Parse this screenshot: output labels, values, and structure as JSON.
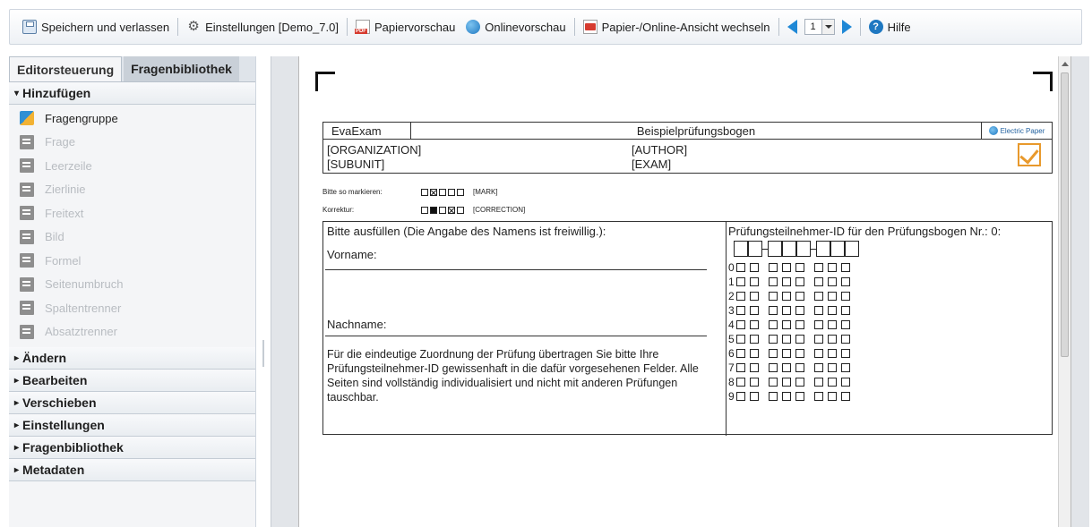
{
  "toolbar": {
    "save_label": "Speichern und verlassen",
    "settings_label": "Einstellungen [Demo_7.0]",
    "paper_preview_label": "Papiervorschau",
    "online_preview_label": "Onlinevorschau",
    "switch_view_label": "Papier-/Online-Ansicht wechseln",
    "page_value": "1",
    "help_label": "Hilfe"
  },
  "sidebar": {
    "tabs": [
      "Editorsteuerung",
      "Fragenbibliothek"
    ],
    "add_section": "Hinzufügen",
    "items": [
      {
        "label": "Fragengruppe",
        "icon": "question-group-icon"
      },
      {
        "label": "Frage",
        "icon": "question-icon"
      },
      {
        "label": "Leerzeile",
        "icon": "blank-line-icon"
      },
      {
        "label": "Zierlinie",
        "icon": "decorative-line-icon"
      },
      {
        "label": "Freitext",
        "icon": "free-text-icon"
      },
      {
        "label": "Bild",
        "icon": "image-icon"
      },
      {
        "label": "Formel",
        "icon": "formula-icon"
      },
      {
        "label": "Seitenumbruch",
        "icon": "page-break-icon"
      },
      {
        "label": "Spaltentrenner",
        "icon": "column-separator-icon"
      },
      {
        "label": "Absatztrenner",
        "icon": "paragraph-separator-icon"
      }
    ],
    "sections": [
      "Ändern",
      "Bearbeiten",
      "Verschieben",
      "Einstellungen",
      "Fragenbibliothek",
      "Metadaten"
    ]
  },
  "document": {
    "header_left": "EvaExam",
    "header_title": "Beispielprüfungsbogen",
    "header_logo": "Electric Paper",
    "organization": "[ORGANIZATION]",
    "subunit": "[SUBUNIT]",
    "author": "[AUTHOR]",
    "exam": "[EXAM]",
    "mark_label": "Bitte so markieren:",
    "mark_tag": "[MARK]",
    "correction_label": "Korrektur:",
    "correction_tag": "[CORRECTION]",
    "fill_title": "Bitte ausfüllen (Die Angabe des Namens ist freiwillig.):",
    "vorname": "Vorname:",
    "nachname": "Nachname:",
    "instruction": "Für die eindeutige Zuordnung der Prüfung übertragen Sie bitte Ihre Prüfungsteilnehmer-ID gewissenhaft in die dafür vorgesehenen Felder. Alle Seiten sind vollständig individualisiert und nicht mit anderen Prüfungen tauschbar.",
    "id_title": "Prüfungsteilnehmer-ID für den Prüfungsbogen Nr.: 0:",
    "digits": [
      "0",
      "1",
      "2",
      "3",
      "4",
      "5",
      "6",
      "7",
      "8",
      "9"
    ]
  }
}
